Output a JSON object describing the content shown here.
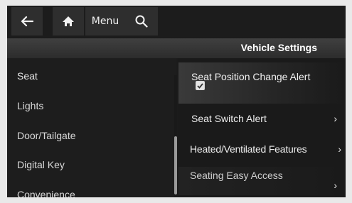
{
  "toolbar": {
    "back_icon": "arrow-left-icon",
    "home_icon": "home-icon",
    "menu_label": "Menu",
    "search_icon": "search-icon"
  },
  "header": {
    "title": "Vehicle Settings"
  },
  "sidebar": {
    "items": [
      {
        "label": "Seat"
      },
      {
        "label": "Lights"
      },
      {
        "label": "Door/Tailgate"
      },
      {
        "label": "Digital Key"
      },
      {
        "label": "Convenience"
      }
    ]
  },
  "options": {
    "items": [
      {
        "label": "Seat Position Change Alert",
        "checked": true
      },
      {
        "label": "Seat Switch Alert",
        "chevron": "›"
      },
      {
        "label": "Heated/Ventilated Features",
        "chevron": "›"
      },
      {
        "label": "Seating Easy Access",
        "chevron": "›"
      }
    ]
  },
  "colors": {
    "background": "#1b1b1b",
    "text": "#eeeeee",
    "outer": "#e9e9e9"
  }
}
